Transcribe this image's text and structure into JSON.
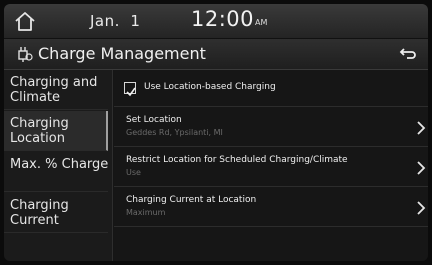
{
  "status": {
    "date": "Jan.  1",
    "time": "12:00",
    "ampm": "AM"
  },
  "header": {
    "title": "Charge Management"
  },
  "sidebar": {
    "items": [
      {
        "label": "Charging and Climate"
      },
      {
        "label": "Charging Location"
      },
      {
        "label": "Max. % Charge"
      },
      {
        "label": "Charging Current"
      }
    ]
  },
  "main": {
    "checkbox_label": "Use Location-based Charging",
    "rows": [
      {
        "label": "Set Location",
        "value": "Geddes Rd, Ypsilanti, MI"
      },
      {
        "label": "Restrict Location for Scheduled Charging/Climate",
        "value": "Use"
      },
      {
        "label": "Charging Current at Location",
        "value": "Maximum"
      }
    ]
  },
  "colors": {
    "background": "#151515",
    "text": "#e8e8e8",
    "subtext": "#6a6a6a"
  }
}
